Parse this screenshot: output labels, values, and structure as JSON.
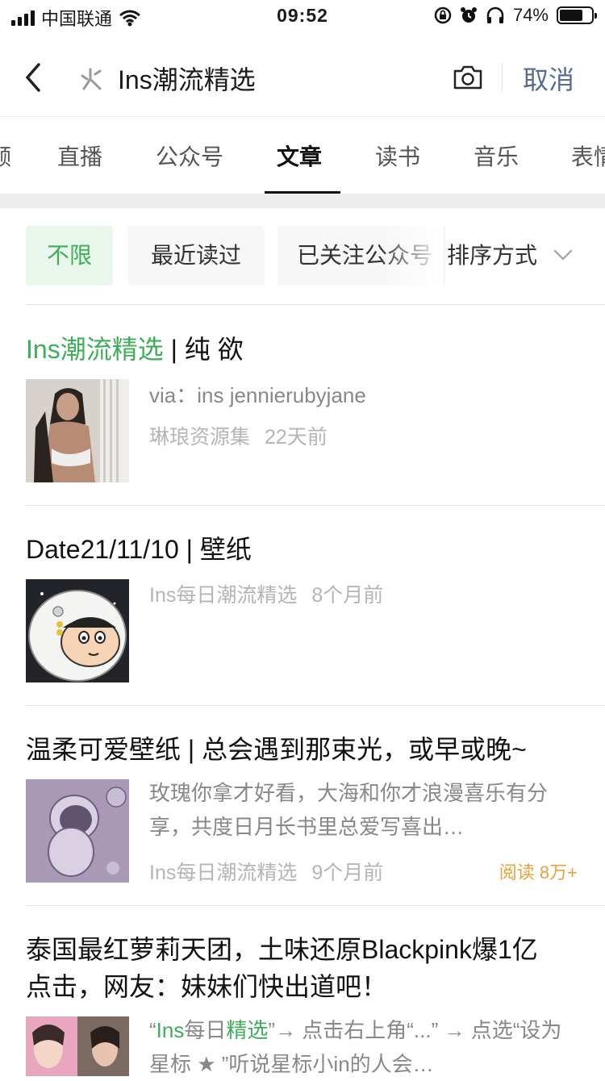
{
  "status_bar": {
    "carrier": "中国联通",
    "time": "09:52",
    "battery_text": "74%",
    "battery_level": 0.74
  },
  "header": {
    "back_icon": "chevron-left-icon",
    "search_query": "Ins潮流精选",
    "cancel_label": "取消"
  },
  "tabs": [
    {
      "label": "频"
    },
    {
      "label": "直播"
    },
    {
      "label": "公众号"
    },
    {
      "label": "文章",
      "active": true
    },
    {
      "label": "读书"
    },
    {
      "label": "音乐"
    },
    {
      "label": "表情"
    }
  ],
  "filters": {
    "chips": [
      "不限",
      "最近读过",
      "已关注公众号"
    ],
    "sort_label": "排序方式"
  },
  "results": [
    {
      "title_hl": "Ins潮流精选",
      "title_rest": " | 纯 欲",
      "desc": "via：ins jennierubyjane",
      "source": "琳琅资源集",
      "time": "22天前"
    },
    {
      "title_rest": "Date21/11/10 | 壁纸",
      "source": "Ins每日潮流精选",
      "time": "8个月前"
    },
    {
      "title_rest": "温柔可爱壁纸 | 总会遇到那束光，或早或晚~",
      "desc": "玫瑰你拿才好看，大海和你才浪漫喜乐有分享，共度日月长书里总爱写喜出…",
      "source": "Ins每日潮流精选",
      "time": "9个月前",
      "reads": "阅读 8万+"
    },
    {
      "title_line1": "泰国最红萝莉天团，土味还原Blackpink爆1亿",
      "title_line2": "点击，网友：妹妹们快出道吧！",
      "desc_pre": "“",
      "desc_hl1": "Ins",
      "desc_mid": "每日",
      "desc_hl2": "精选",
      "desc_post": "”→ 点击右上角“...” → 点选“设为星标 ★ ”听说星标小in的人会…"
    }
  ],
  "colors": {
    "accent_green": "#3fae5a",
    "cancel_blue": "#576b95",
    "reads_orange": "#e6a23c"
  }
}
